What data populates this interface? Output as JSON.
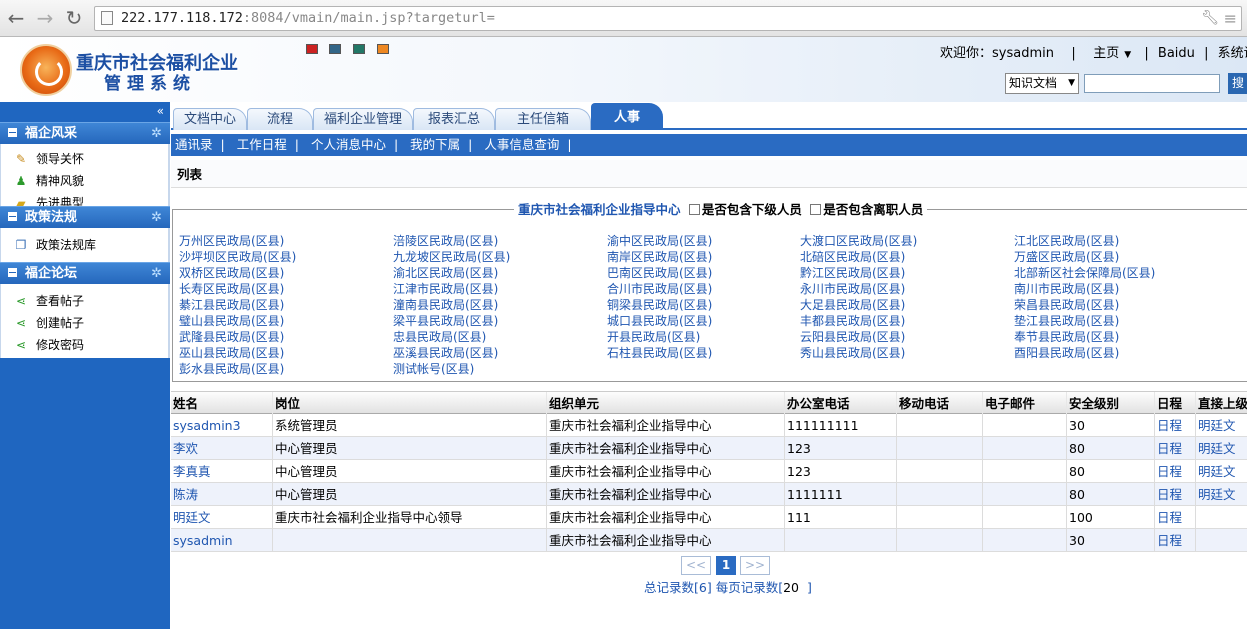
{
  "browser": {
    "url_host": "222.177.118.172",
    "url_rest": ":8084/vmain/main.jsp?targeturl="
  },
  "header": {
    "title_line1": "重庆市社会福利企业",
    "title_line2": "管理系统",
    "welcome": "欢迎你：sysadmin",
    "links": [
      "主页",
      "Baidu",
      "系统设置"
    ],
    "theme_colors": [
      "#cc2222",
      "#336688",
      "#227766",
      "#ee8822"
    ],
    "search_select": "知识文档",
    "search_button": "搜"
  },
  "sidebar": {
    "collapse": "«",
    "sections": [
      {
        "title": "福企风采",
        "items": [
          "领导关怀",
          "精神风貌",
          "先进典型"
        ]
      },
      {
        "title": "政策法规",
        "items": [
          "政策法规库"
        ]
      },
      {
        "title": "福企论坛",
        "items": [
          "查看帖子",
          "创建帖子",
          "修改密码"
        ]
      }
    ]
  },
  "tabs": [
    "文档中心",
    "流程",
    "福利企业管理",
    "报表汇总",
    "主任信箱",
    "人事"
  ],
  "active_tab": "人事",
  "subnav": [
    "通讯录",
    "工作日程",
    "个人消息中心",
    "我的下属",
    "人事信息查询"
  ],
  "list_title": "列表",
  "filter": {
    "org": "重庆市社会福利企业指导中心",
    "include_sub": "是否包含下级人员",
    "include_left": "是否包含离职人员"
  },
  "bureaus": [
    [
      "万州区民政局(区县)",
      "涪陵区民政局(区县)",
      "渝中区民政局(区县)",
      "大渡口区民政局(区县)",
      "江北区民政局(区县)"
    ],
    [
      "沙坪坝区民政局(区县)",
      "九龙坡区民政局(区县)",
      "南岸区民政局(区县)",
      "北碚区民政局(区县)",
      "万盛区民政局(区县)"
    ],
    [
      "双桥区民政局(区县)",
      "渝北区民政局(区县)",
      "巴南区民政局(区县)",
      "黔江区民政局(区县)",
      "北部新区社会保障局(区县)"
    ],
    [
      "长寿区民政局(区县)",
      "江津市民政局(区县)",
      "合川市民政局(区县)",
      "永川市民政局(区县)",
      "南川市民政局(区县)"
    ],
    [
      "綦江县民政局(区县)",
      "潼南县民政局(区县)",
      "铜梁县民政局(区县)",
      "大足县民政局(区县)",
      "荣昌县民政局(区县)"
    ],
    [
      "璧山县民政局(区县)",
      "梁平县民政局(区县)",
      "城口县民政局(区县)",
      "丰都县民政局(区县)",
      "垫江县民政局(区县)"
    ],
    [
      "武隆县民政局(区县)",
      "忠县民政局(区县)",
      "开县民政局(区县)",
      "云阳县民政局(区县)",
      "奉节县民政局(区县)"
    ],
    [
      "巫山县民政局(区县)",
      "巫溪县民政局(区县)",
      "石柱县民政局(区县)",
      "秀山县民政局(区县)",
      "酉阳县民政局(区县)"
    ],
    [
      "彭水县民政局(区县)",
      "测试帐号(区县)",
      "",
      "",
      ""
    ]
  ],
  "table": {
    "columns": [
      "姓名",
      "岗位",
      "组织单元",
      "办公室电话",
      "移动电话",
      "电子邮件",
      "安全级别",
      "日程",
      "直接上级"
    ],
    "rows": [
      [
        "sysadmin3",
        "系统管理员",
        "重庆市社会福利企业指导中心",
        "111111111",
        "",
        "",
        "30",
        "日程",
        "明廷文"
      ],
      [
        "李欢",
        "中心管理员",
        "重庆市社会福利企业指导中心",
        "123",
        "",
        "",
        "80",
        "日程",
        "明廷文"
      ],
      [
        "李真真",
        "中心管理员",
        "重庆市社会福利企业指导中心",
        "123",
        "",
        "",
        "80",
        "日程",
        "明廷文"
      ],
      [
        "陈涛",
        "中心管理员",
        "重庆市社会福利企业指导中心",
        "1111111",
        "",
        "",
        "80",
        "日程",
        "明廷文"
      ],
      [
        "明廷文",
        "重庆市社会福利企业指导中心领导",
        "重庆市社会福利企业指导中心",
        "111",
        "",
        "",
        "100",
        "日程",
        ""
      ],
      [
        "sysadmin",
        "",
        "重庆市社会福利企业指导中心",
        "",
        "",
        "",
        "30",
        "日程",
        ""
      ]
    ]
  },
  "pager": {
    "prev": "<<",
    "current": "1",
    "next": ">>",
    "total_label": "总记录数[6]",
    "per_page_label": "每页记录数[",
    "per_page_value": "20",
    "per_page_end": "]"
  }
}
